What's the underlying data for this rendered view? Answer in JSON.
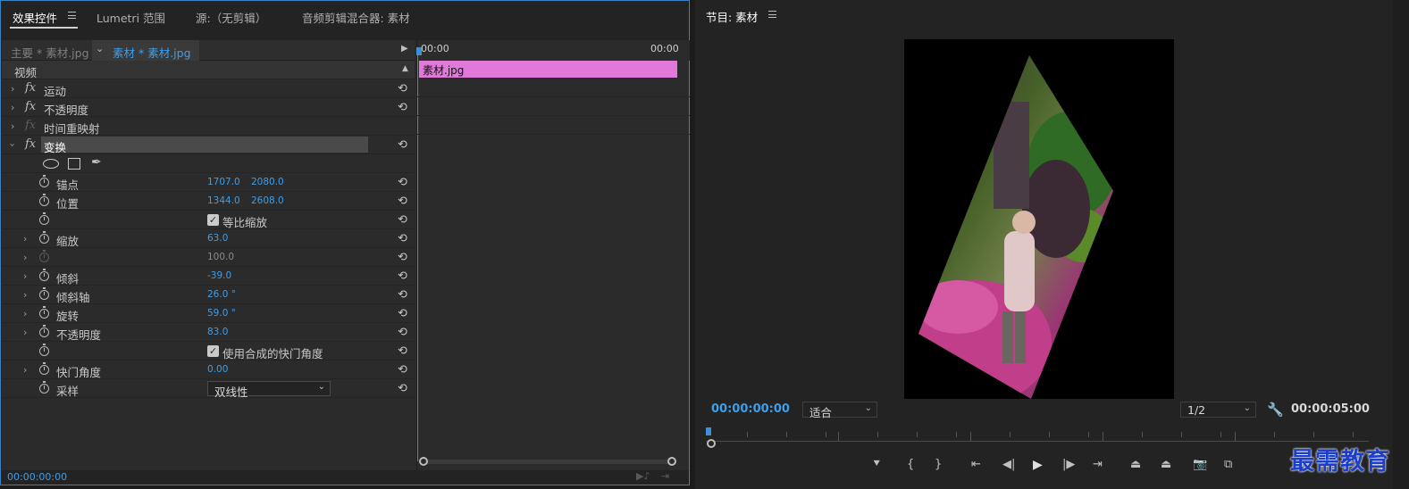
{
  "left_tabs": {
    "effect_controls": "效果控件",
    "lumetri": "Lumetri 范围",
    "source": "源:（无剪辑）",
    "audio_mixer": "音频剪辑混合器: 素材"
  },
  "clip_header": {
    "master": "主要 * 素材.jpg",
    "sequence_clip": "素材 * 素材.jpg"
  },
  "timeline": {
    "start_time": "00:00",
    "end_time": "00:00",
    "clip_name": "素材.jpg"
  },
  "video_section": "视频",
  "effects": {
    "motion": "运动",
    "opacity": "不透明度",
    "time_remap": "时间重映射",
    "transform": "变换"
  },
  "transform_props": {
    "anchor": {
      "label": "锚点",
      "x": "1707.0",
      "y": "2080.0"
    },
    "position": {
      "label": "位置",
      "x": "1344.0",
      "y": "2608.0"
    },
    "uniform_scale": {
      "label": "等比缩放",
      "checked": true
    },
    "scale": {
      "label": "缩放",
      "value": "63.0"
    },
    "scale_width": {
      "value": "100.0"
    },
    "skew": {
      "label": "倾斜",
      "value": "-39.0"
    },
    "skew_axis": {
      "label": "倾斜轴",
      "value": "26.0 °"
    },
    "rotation": {
      "label": "旋转",
      "value": "59.0 °"
    },
    "opacity": {
      "label": "不透明度",
      "value": "83.0"
    },
    "composition_shutter": {
      "label": "使用合成的快门角度",
      "checked": true
    },
    "shutter_angle": {
      "label": "快门角度",
      "value": "0.00"
    },
    "sampling": {
      "label": "采样",
      "value": "双线性"
    }
  },
  "left_footer_time": "00:00:00:00",
  "program": {
    "title": "节目: 素材",
    "timecode_current": "00:00:00:00",
    "fit": "适合",
    "resolution": "1/2",
    "timecode_duration": "00:00:05:00"
  },
  "watermark": "最需教育",
  "colors": {
    "accent_blue": "#3d9eeb",
    "clip_pink": "#e079d9",
    "panel_border": "#3a82c8"
  },
  "icons": [
    "menu-icon",
    "stopwatch-icon",
    "reset-icon",
    "fx-icon",
    "ellipse-mask-icon",
    "rect-mask-icon",
    "pen-mask-icon",
    "wrench-icon",
    "camera-icon"
  ]
}
